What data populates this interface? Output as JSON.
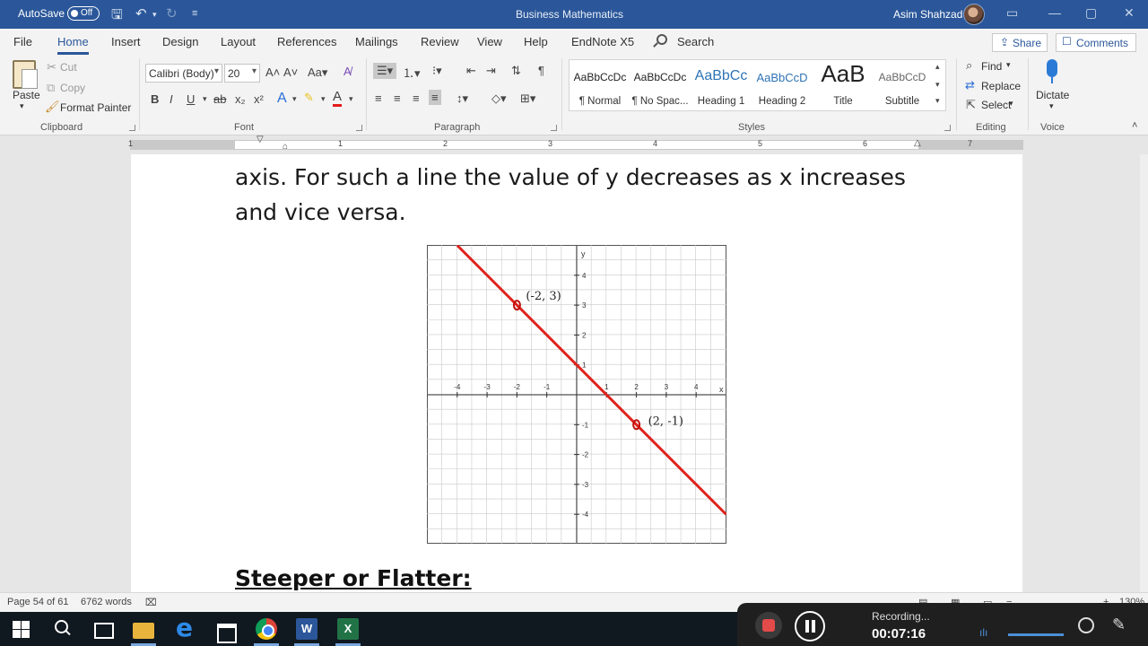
{
  "titlebar": {
    "autosave_label": "AutoSave",
    "autosave_state": "Off",
    "document_title": "Business Mathematics",
    "user_name": "Asim Shahzad"
  },
  "menu": {
    "tabs": [
      "File",
      "Home",
      "Insert",
      "Design",
      "Layout",
      "References",
      "Mailings",
      "Review",
      "View",
      "Help",
      "EndNote X5"
    ],
    "active_tab": "Home",
    "search_label": "Search",
    "share_label": "Share",
    "comments_label": "Comments"
  },
  "ribbon": {
    "clipboard": {
      "label": "Clipboard",
      "paste": "Paste",
      "cut": "Cut",
      "copy": "Copy",
      "format_painter": "Format Painter"
    },
    "font": {
      "label": "Font",
      "font_name": "Calibri (Body)",
      "font_size": "20"
    },
    "paragraph": {
      "label": "Paragraph"
    },
    "styles": {
      "label": "Styles",
      "items": [
        {
          "preview": "AaBbCcDc",
          "name": "¶ Normal"
        },
        {
          "preview": "AaBbCcDc",
          "name": "¶ No Spac..."
        },
        {
          "preview": "AaBbCc",
          "name": "Heading 1"
        },
        {
          "preview": "AaBbCcD",
          "name": "Heading 2"
        },
        {
          "preview": "AaB",
          "name": "Title"
        },
        {
          "preview": "AaBbCcD",
          "name": "Subtitle"
        }
      ]
    },
    "editing": {
      "label": "Editing",
      "find": "Find",
      "replace": "Replace",
      "select": "Select"
    },
    "voice": {
      "label": "Voice",
      "dictate": "Dictate"
    }
  },
  "ruler": {
    "numbers": [
      "1",
      "1",
      "2",
      "3",
      "4",
      "5",
      "6",
      "7"
    ]
  },
  "document": {
    "paragraph": "axis. For such a line the value of y decreases as x increases and vice versa.",
    "heading": "Steeper or Flatter:",
    "graph": {
      "x_ticks": [
        "-4",
        "-3",
        "-2",
        "-1",
        "1",
        "2",
        "3",
        "4"
      ],
      "y_ticks": [
        "4",
        "3",
        "2",
        "1",
        "-1",
        "-2",
        "-3",
        "-4"
      ],
      "x_axis_label": "x",
      "y_axis_label": "y",
      "point_labels": [
        "(-2, 3)",
        "(2, -1)"
      ],
      "line_color": "#e0221c"
    }
  },
  "statusbar": {
    "page": "Page 54 of 61",
    "words": "6762 words",
    "zoom": "130%"
  },
  "recorder": {
    "status": "Recording...",
    "time": "00:07:16"
  },
  "chart_data": {
    "type": "line",
    "x": [
      -2,
      2
    ],
    "y": [
      3,
      -1
    ],
    "xlim": [
      -5,
      5
    ],
    "ylim": [
      -5,
      5
    ],
    "xlabel": "x",
    "ylabel": "y",
    "grid": true,
    "points": [
      {
        "x": -2,
        "y": 3,
        "label": "(-2, 3)"
      },
      {
        "x": 2,
        "y": -1,
        "label": "(2, -1)"
      }
    ]
  }
}
